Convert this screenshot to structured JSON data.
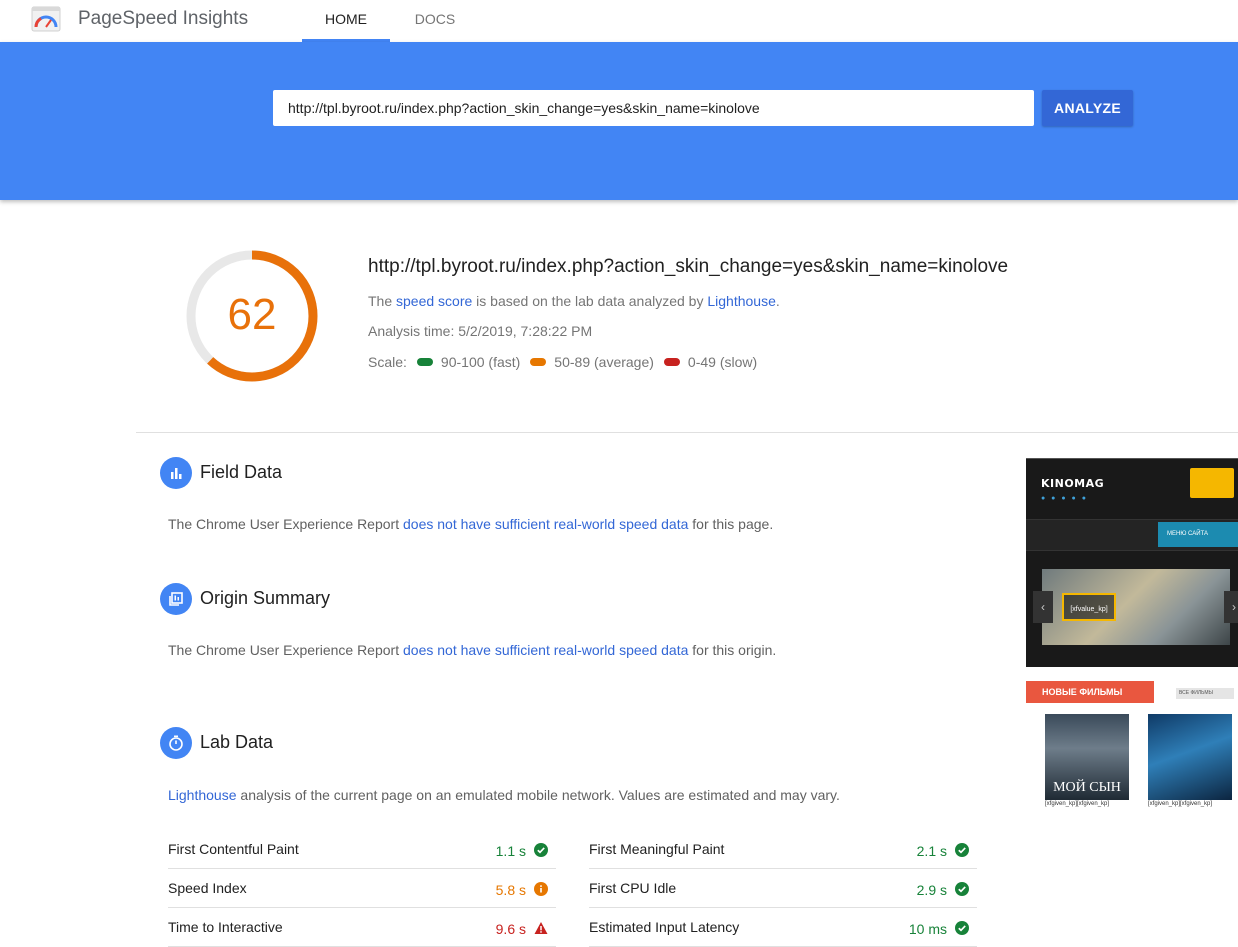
{
  "header": {
    "app_title": "PageSpeed Insights",
    "tabs": [
      {
        "label": "HOME",
        "active": true
      },
      {
        "label": "DOCS",
        "active": false
      }
    ]
  },
  "search": {
    "url_value": "http://tpl.byroot.ru/index.php?action_skin_change=yes&skin_name=kinolove",
    "analyze_label": "ANALYZE"
  },
  "summary": {
    "score": "62",
    "score_fraction": 0.62,
    "tested_url": "http://tpl.byroot.ru/index.php?action_skin_change=yes&skin_name=kinolove",
    "info_prefix": "The ",
    "info_link1": "speed score",
    "info_middle": " is based on the lab data analyzed by ",
    "info_link2": "Lighthouse",
    "info_suffix": ".",
    "analysis_time": "Analysis time: 5/2/2019, 7:28:22 PM",
    "scale_label": "Scale:",
    "scale": [
      {
        "label": "90-100 (fast)",
        "color": "#178239"
      },
      {
        "label": "50-89 (average)",
        "color": "#e67700"
      },
      {
        "label": "0-49 (slow)",
        "color": "#c7221f"
      }
    ]
  },
  "field_data": {
    "title": "Field Data",
    "text_prefix": "The Chrome User Experience Report ",
    "link": "does not have sufficient real-world speed data",
    "text_suffix": " for this page."
  },
  "origin_summary": {
    "title": "Origin Summary",
    "text_prefix": "The Chrome User Experience Report ",
    "link": "does not have sufficient real-world speed data",
    "text_suffix": " for this origin."
  },
  "lab_data": {
    "title": "Lab Data",
    "link": "Lighthouse",
    "text": " analysis of the current page on an emulated mobile network. Values are estimated and may vary.",
    "metrics": [
      {
        "name": "First Contentful Paint",
        "value": "1.1 s",
        "status": "good"
      },
      {
        "name": "First Meaningful Paint",
        "value": "2.1 s",
        "status": "good"
      },
      {
        "name": "Speed Index",
        "value": "5.8 s",
        "status": "average"
      },
      {
        "name": "First CPU Idle",
        "value": "2.9 s",
        "status": "good"
      },
      {
        "name": "Time to Interactive",
        "value": "9.6 s",
        "status": "slow"
      },
      {
        "name": "Estimated Input Latency",
        "value": "10 ms",
        "status": "good"
      }
    ]
  },
  "screenshot": {
    "site_logo": "KINOMAG",
    "menu_label": "МЕНЮ САЙТА",
    "slider_badge": "[xfvalue_kp]",
    "new_films": "НОВЫЕ ФИЛЬМЫ",
    "all_films": "ВСЕ ФИЛЬМЫ",
    "poster1_title": "МОЙ СЫН",
    "poster_caption": "[xfgiven_kp][xfgiven_kp]"
  },
  "colors": {
    "brand_blue": "#4285f4",
    "button_blue": "#3367d6",
    "score_orange": "#e8710a"
  }
}
